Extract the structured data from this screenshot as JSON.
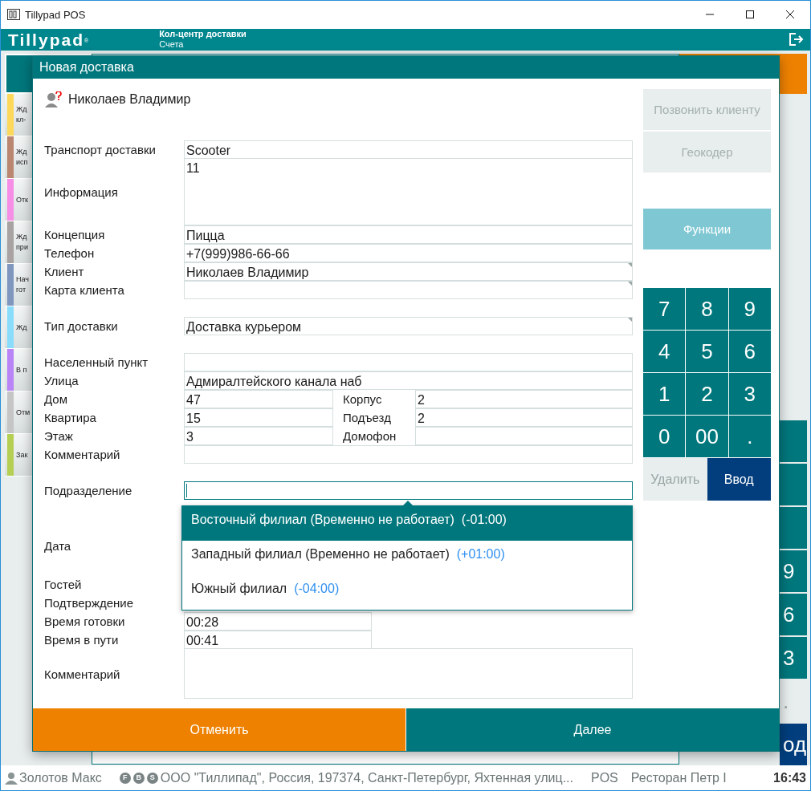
{
  "window": {
    "title": "Tillypad POS"
  },
  "header": {
    "logo": "Tillypad",
    "logo_mark": "®",
    "title": "Кол-центр доставки",
    "subtitle": "Счета"
  },
  "background": {
    "status_list": [
      {
        "color": "#fdd85a",
        "lines": [
          "Жд",
          "кл-"
        ]
      },
      {
        "color": "#bb8670",
        "lines": [
          "Жд",
          "исп"
        ]
      },
      {
        "color": "#f78ee6",
        "lines": [
          "Отк"
        ]
      },
      {
        "color": "#a8a2a2",
        "lines": [
          "Жд",
          "при"
        ]
      },
      {
        "color": "#7f97bf",
        "lines": [
          "Нач",
          "гот"
        ]
      },
      {
        "color": "#89dcfb",
        "lines": [
          "Жд"
        ]
      },
      {
        "color": "#b884f6",
        "lines": [
          "В п"
        ]
      },
      {
        "color": "#c5c5c5",
        "lines": [
          "Отм"
        ]
      },
      {
        "color": "#b5cf55",
        "lines": [
          "Зак"
        ]
      }
    ],
    "side_keys": [
      {
        "kind": "digit"
      },
      {
        "kind": "digit"
      },
      {
        "kind": "digit"
      },
      {
        "label": "9",
        "kind": "digit"
      },
      {
        "label": "6",
        "kind": "digit"
      },
      {
        "label": "3",
        "kind": "digit"
      },
      {
        "label": ".",
        "kind": "light"
      },
      {
        "label": "од",
        "kind": "enter"
      }
    ]
  },
  "dialog": {
    "title": "Новая доставка",
    "client": "Николаев Владимир",
    "sections": [
      {
        "rows": [
          {
            "label": "Транспорт доставки",
            "kind": "text",
            "value": "Scooter"
          },
          {
            "label": "Информация",
            "kind": "memo",
            "value": "11"
          },
          {
            "label": "Концепция",
            "kind": "text",
            "value": "Пицца"
          },
          {
            "label": "Телефон",
            "kind": "text",
            "value": "+7(999)986-66-66"
          },
          {
            "label": "Клиент",
            "kind": "lookup",
            "value": "Николаев Владимир"
          },
          {
            "label": "Карта клиента",
            "kind": "lookup"
          }
        ]
      },
      {
        "rows": [
          {
            "label": "Тип доставки",
            "kind": "lookup",
            "value": "Доставка курьером"
          }
        ]
      },
      {
        "rows": [
          {
            "label": "Населенный пункт",
            "kind": "text"
          },
          {
            "label": "Улица",
            "kind": "text",
            "value": "Адмиралтейского канала наб"
          },
          {
            "label": "Дом",
            "kind": "split",
            "value": "47",
            "label2": "Корпус",
            "value2": "2"
          },
          {
            "label": "Квартира",
            "kind": "split",
            "value": "15",
            "label2": "Подъезд",
            "value2": "2"
          },
          {
            "label": "Этаж",
            "kind": "split",
            "value": "3",
            "label2": "Домофон"
          },
          {
            "label": "Комментарий",
            "kind": "text"
          }
        ]
      },
      {
        "rows": [
          {
            "label": "Подразделение",
            "kind": "input",
            "focused": true
          }
        ]
      },
      {
        "rows": [
          {
            "label": "Дата",
            "kind": "covered"
          }
        ]
      },
      {
        "rows": [
          {
            "label": "Гостей",
            "kind": "covered"
          },
          {
            "label": "Подтверждение",
            "kind": "covered"
          },
          {
            "label": "Время готовки",
            "kind": "short",
            "value": "00:28"
          },
          {
            "label": "Время в пути",
            "kind": "short",
            "value": "00:41"
          },
          {
            "label": "Комментарий",
            "kind": "memo_tall"
          }
        ]
      }
    ],
    "dropdown": [
      {
        "name": "Восточный филиал (Временно не работает)",
        "offset": "(-01:00)",
        "selected": true
      },
      {
        "name": "Западный филиал (Временно не работает)",
        "offset": "(+01:00)",
        "selected": false
      },
      {
        "name": "Южный филиал",
        "offset": "(-04:00)",
        "selected": false
      }
    ],
    "actions": [
      {
        "label": "Позвонить клиенту",
        "disabled": true
      },
      {
        "label": "Геокодер",
        "disabled": true
      },
      {
        "label": "Функции",
        "disabled": false
      }
    ],
    "keypad": [
      {
        "label": "7",
        "kind": "digit"
      },
      {
        "label": "8",
        "kind": "digit"
      },
      {
        "label": "9",
        "kind": "digit"
      },
      {
        "label": "4",
        "kind": "digit"
      },
      {
        "label": "5",
        "kind": "digit"
      },
      {
        "label": "6",
        "kind": "digit"
      },
      {
        "label": "1",
        "kind": "digit"
      },
      {
        "label": "2",
        "kind": "digit"
      },
      {
        "label": "3",
        "kind": "digit"
      },
      {
        "label": "0",
        "kind": "digit"
      },
      {
        "label": "00",
        "kind": "digit"
      },
      {
        "label": ".",
        "kind": "digit"
      },
      {
        "label": "Удалить",
        "kind": "delete"
      },
      {
        "label": "Ввод",
        "kind": "enter"
      }
    ],
    "footer": [
      {
        "label": "Отменить",
        "kind": "cancel"
      },
      {
        "label": "Далее",
        "kind": "next"
      }
    ]
  },
  "status_bar": {
    "user": "Золотов Макс",
    "badges": [
      "F",
      "B",
      "S"
    ],
    "address": "ООО \"Тиллипад\", Россия, 197374, Санкт-Петербург, Яхтенная улиц...",
    "terminal": "POS",
    "restaurant": "Ресторан Петр I",
    "time": "16:43"
  }
}
